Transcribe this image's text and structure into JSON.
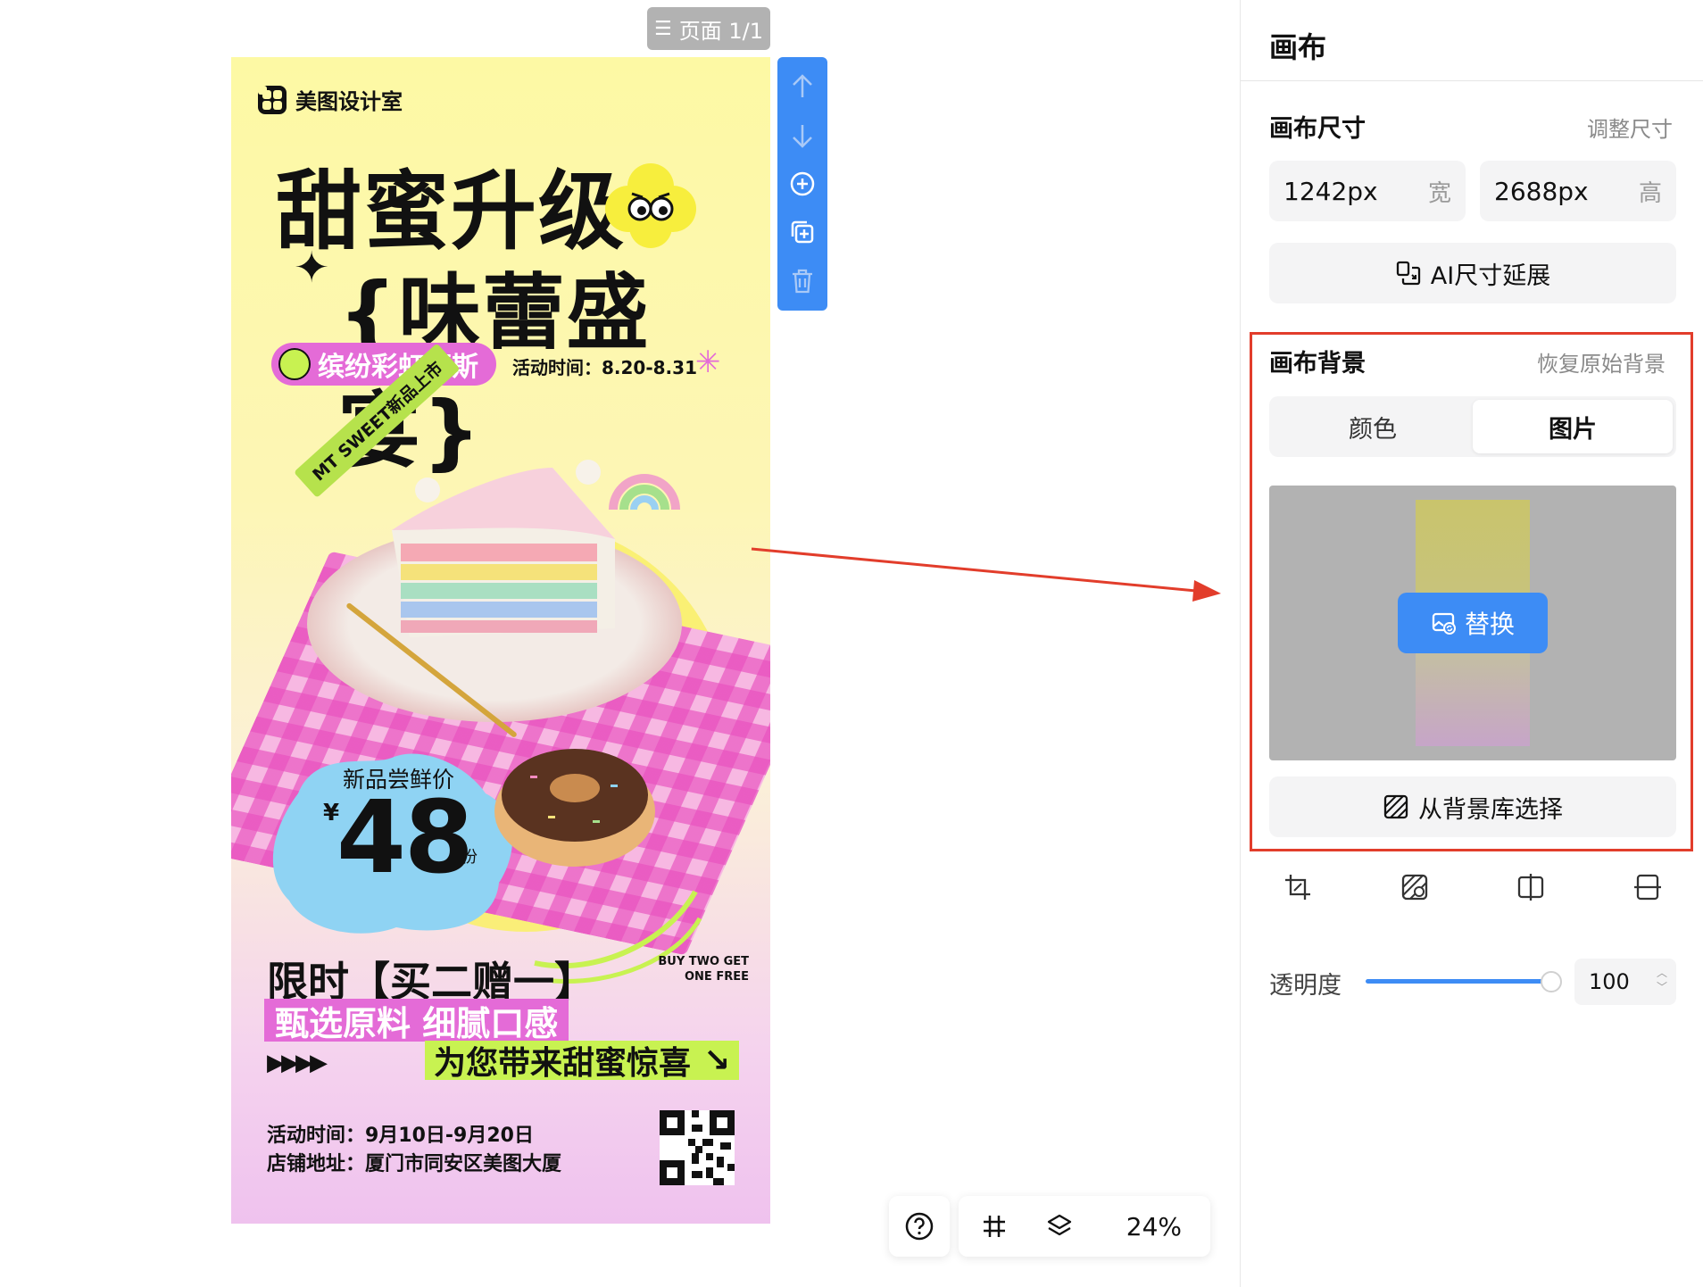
{
  "canvas": {
    "page_indicator": "页面 1/1",
    "poster": {
      "brand": "美图设计室",
      "headline_line1": "甜蜜升级",
      "headline_line2": "{味蕾盛宴}",
      "pill_text": "缤纷彩虹慕斯",
      "activity_time": "活动时间：8.20-8.31",
      "sticker": "MT SWEET新品上市",
      "price_label": "新品尝鲜价",
      "price_currency": "¥",
      "price_value": "48",
      "price_unit": "份",
      "limited_offer": "限时【买二赠一】",
      "buy_two_line1": "BUY TWO GET",
      "buy_two_line2": "ONE FREE",
      "highlight_pink": "甄选原料 细腻口感",
      "highlight_green": "为您带来甜蜜惊喜",
      "highlight_green_arrow": "↘",
      "arrows": "▶▶▶▶",
      "info_time": "活动时间：9月10日-9月20日",
      "info_address": "店铺地址：厦门市同安区美图大厦"
    },
    "side_toolbar": [
      "move-up-icon",
      "move-down-icon",
      "add-page-icon",
      "duplicate-page-icon",
      "delete-page-icon"
    ],
    "bottom_bar": {
      "zoom": "24%"
    }
  },
  "panel": {
    "title": "画布",
    "size_section": {
      "title": "画布尺寸",
      "adjust_link": "调整尺寸",
      "width_value": "1242px",
      "width_unit": "宽",
      "height_value": "2688px",
      "height_unit": "高",
      "ai_extend_label": "AI尺寸延展"
    },
    "background_section": {
      "title": "画布背景",
      "restore_link": "恢复原始背景",
      "tabs": [
        "颜色",
        "图片"
      ],
      "active_tab": "图片",
      "replace_label": "替换",
      "library_label": "从背景库选择"
    },
    "opacity": {
      "label": "透明度",
      "value": "100"
    }
  },
  "colors": {
    "accent_blue": "#3d8cf5",
    "annotation_red": "#e23d2b",
    "poster_pink": "#e46bd7",
    "poster_green": "#c8f251"
  }
}
